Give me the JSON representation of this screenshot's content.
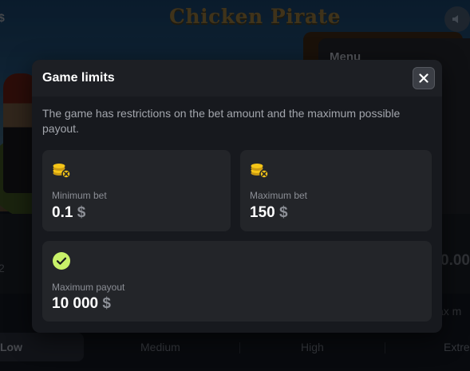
{
  "game": {
    "logo_text": "Chicken Pirate",
    "currency_symbol": "$",
    "menu_label": "Menu",
    "bet_side_labels": [
      "2",
      "0.00",
      "ax m"
    ],
    "difficulty_tabs": [
      "Low",
      "Medium",
      "High",
      "Extre"
    ],
    "active_difficulty": "Low"
  },
  "modal": {
    "title": "Game limits",
    "description": "The game has restrictions on the bet amount and the maximum possible payout.",
    "close_icon": "close-icon",
    "cards": {
      "min_bet": {
        "icon": "coins-limit-icon",
        "label": "Minimum bet",
        "value": "0.1",
        "currency": "$"
      },
      "max_bet": {
        "icon": "coins-limit-icon",
        "label": "Maximum bet",
        "value": "150",
        "currency": "$"
      },
      "max_payout": {
        "icon": "check-circle-icon",
        "label": "Maximum payout",
        "value": "10 000",
        "currency": "$"
      }
    }
  },
  "colors": {
    "accent_green": "#c8f169",
    "coin_yellow": "#f5c518",
    "modal_bg": "#17191e",
    "card_bg": "#232529"
  }
}
